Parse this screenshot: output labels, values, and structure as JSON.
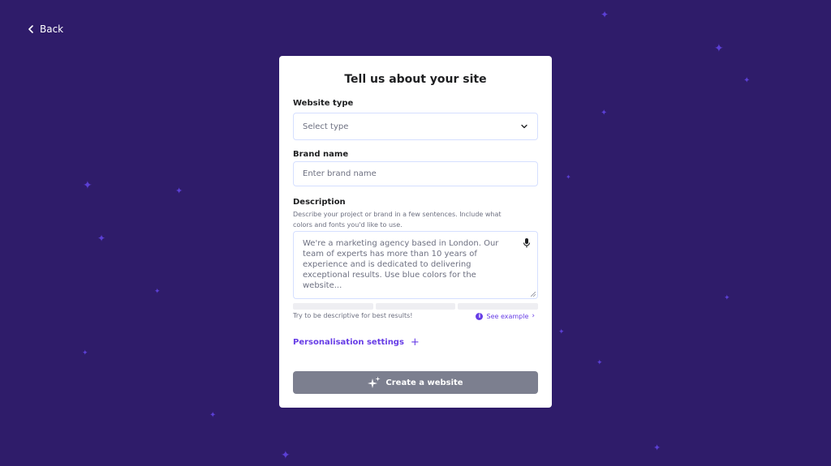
{
  "nav": {
    "back_label": "Back"
  },
  "form": {
    "title": "Tell us about your site",
    "website_type": {
      "label": "Website type",
      "placeholder": "Select type"
    },
    "brand_name": {
      "label": "Brand name",
      "placeholder": "Enter brand name"
    },
    "description": {
      "label": "Description",
      "hint": "Describe your project or brand in a few sentences. Include what colors and fonts you'd like to use.",
      "placeholder": "We're a marketing agency based in London. Our team of experts has more than 10 years of experience and is dedicated to delivering exceptional results. Use blue colors for the website...",
      "helper": "Try to be descriptive for best results!",
      "see_example_label": "See example"
    },
    "personalisation_label": "Personalisation settings",
    "submit_label": "Create a website"
  },
  "icons": {
    "back": "chevron-left-icon",
    "select": "chevron-down-icon",
    "mic": "microphone-icon",
    "info": "info-icon",
    "plus": "plus-icon",
    "sparkle": "sparkle-icon"
  },
  "colors": {
    "background": "#2f1c6a",
    "accent": "#673de6",
    "button_disabled": "#7c7f8f",
    "star": "#5b3fd4"
  }
}
